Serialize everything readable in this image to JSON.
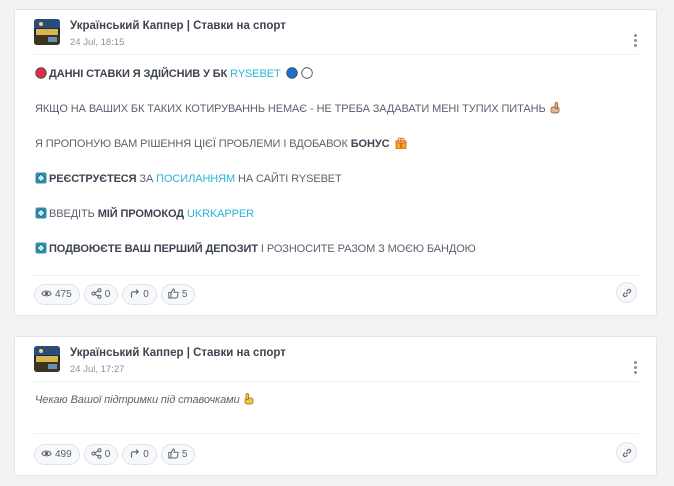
{
  "colors": {
    "link": "#2ab3d6",
    "text": "#5a6270",
    "title": "#3d4451",
    "muted": "#8b929d"
  },
  "posts": [
    {
      "channel": "Український Каппер | Ставки на спорт",
      "date": "24 Jul, 18:15",
      "lines": {
        "l1": {
          "a": "ДАННІ СТАВКИ Я ЗДІЙСНИВ У БК ",
          "link": "RYSEBET"
        },
        "l2": {
          "text": "ЯКЩО НА ВАШИХ БК ТАКИХ КОТИРУВАННЬ НЕМАЄ - НЕ ТРЕБА ЗАДАВАТИ МЕНІ ТУПИХ ПИТАНЬ"
        },
        "l3": {
          "a": "Я ПРОПОНУЮ ВАМ РІШЕННЯ ЦІЄЇ ПРОБЛЕМИ І ВДОБАВОК ",
          "bold": "БОНУС"
        },
        "l4": {
          "bold": "РЕЄСТРУЄТЕСЯ",
          "a": " ЗА ",
          "link": "ПОСИЛАННЯМ",
          "b": " НА САЙТІ RYSEBET"
        },
        "l5": {
          "a": "ВВЕДІТЬ ",
          "bold": "МІЙ ПРОМОКОД",
          "b": " ",
          "link": "UKRKAPPER"
        },
        "l6": {
          "bold": "ПОДВОЮЄТЕ ВАШ ПЕРШИЙ ДЕПОЗИТ",
          "a": " І РОЗНОСИТЕ РАЗОМ З МОЄЮ БАНДОЮ"
        }
      },
      "stats": {
        "views": "475",
        "forwards": "0",
        "replies": "0",
        "likes": "5"
      }
    },
    {
      "channel": "Український Каппер | Ставки на спорт",
      "date": "24 Jul, 17:27",
      "text": "Чекаю Вашої підтримки під ставочками",
      "stats": {
        "views": "499",
        "forwards": "0",
        "replies": "0",
        "likes": "5"
      }
    }
  ]
}
